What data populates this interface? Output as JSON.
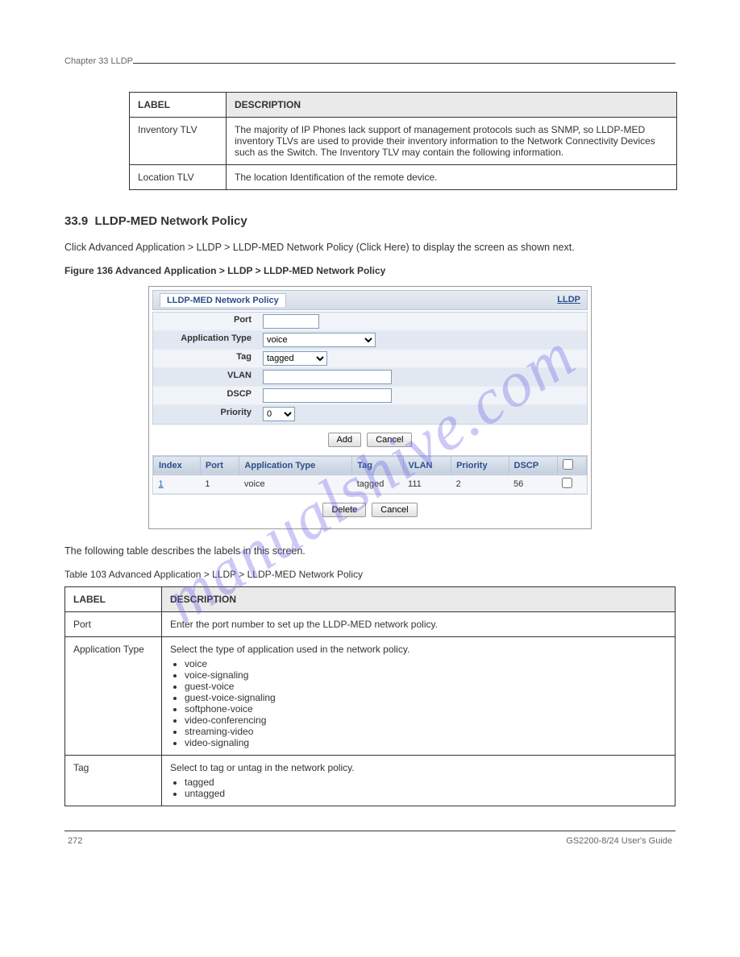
{
  "watermark": "manualshive.com",
  "chapter_left": "Chapter 33 LLDP",
  "chapter_right": "GS2200-8/24 User's Guide",
  "page_number": "272",
  "table1": {
    "headers": [
      "LABEL",
      "DESCRIPTION"
    ],
    "rows": [
      {
        "label": "Inventory TLV",
        "desc": "The majority of IP Phones lack support of management protocols such as SNMP, so LLDP-MED inventory TLVs are used to provide their inventory information to the Network Connectivity Devices such as the Switch. The Inventory TLV may contain the following information."
      },
      {
        "label": "Location TLV",
        "desc": "The location Identification of the remote device."
      }
    ]
  },
  "section_num": "33.9",
  "section_title": "LLDP-MED Network Policy",
  "paragraph": "Click Advanced Application > LLDP > LLDP-MED Network Policy (Click Here) to display the screen as shown next.",
  "fig_caption": "Figure 136   Advanced Application > LLDP > LLDP-MED Network Policy",
  "screenshot": {
    "header": "LLDP-MED Network Policy",
    "link": "LLDP",
    "form": {
      "port_label": "Port",
      "port_value": "",
      "apptype_label": "Application Type",
      "apptype_value": "voice",
      "tag_label": "Tag",
      "tag_value": "tagged",
      "vlan_label": "VLAN",
      "vlan_value": "",
      "dscp_label": "DSCP",
      "dscp_value": "",
      "priority_label": "Priority",
      "priority_value": "0"
    },
    "add_btn": "Add",
    "cancel_btn": "Cancel",
    "delete_btn": "Delete",
    "cancel2_btn": "Cancel",
    "table_headers": [
      "Index",
      "Port",
      "Application Type",
      "Tag",
      "VLAN",
      "Priority",
      "DSCP",
      ""
    ],
    "table_rows": [
      {
        "index": "1",
        "port": "1",
        "apptype": "voice",
        "tag": "tagged",
        "vlan": "111",
        "priority": "2",
        "dscp": "56"
      }
    ]
  },
  "table2_intro": "The following table describes the labels in this screen.",
  "table2_caption": "Table 103   Advanced Application > LLDP > LLDP-MED Network Policy",
  "table2": {
    "headers": [
      "LABEL",
      "DESCRIPTION"
    ],
    "rows": [
      {
        "label": "Port",
        "desc": "Enter the port number to set up the LLDP-MED network policy."
      },
      {
        "label": "Application Type",
        "desc_intro": "Select the type of application used in the network policy.",
        "bullets": [
          "voice",
          "voice-signaling",
          "guest-voice",
          "guest-voice-signaling",
          "softphone-voice",
          "video-conferencing",
          "streaming-video",
          "video-signaling"
        ]
      },
      {
        "label": "Tag",
        "desc_intro": "Select to tag or untag in the network policy.",
        "bullets": [
          "tagged",
          "untagged"
        ]
      }
    ]
  }
}
